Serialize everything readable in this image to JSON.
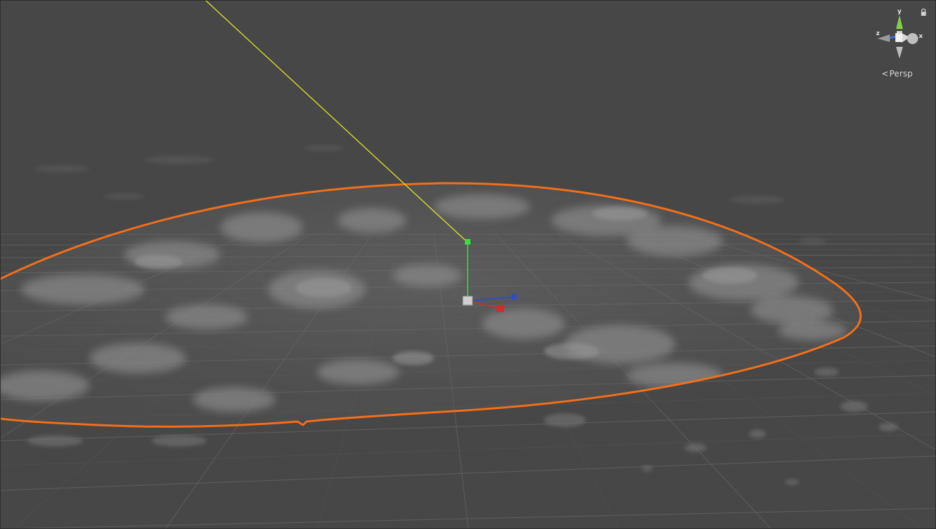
{
  "view": {
    "projection_label": "Persp",
    "background_color": "#474747",
    "grid_color": "#5c5c5c",
    "selection_outline_color": "#f36f1a",
    "light_ray_color": "#e5e52a"
  },
  "orientation_gizmo": {
    "axis_y_label": "y",
    "axis_x_label": "x",
    "axis_z_label": "z",
    "axis_y_color": "#7fd34a",
    "axis_x_color": "#d8d8d8",
    "axis_z_color": "#3b6bd6",
    "icon": "orientation-gizmo-icon"
  },
  "lock": {
    "icon": "lock-icon"
  },
  "transform_handle": {
    "y_axis_color": "#39e23a",
    "x_axis_color": "#d22b2b",
    "z_axis_color": "#2b4bd6",
    "center_color": "#cfcfcf"
  }
}
